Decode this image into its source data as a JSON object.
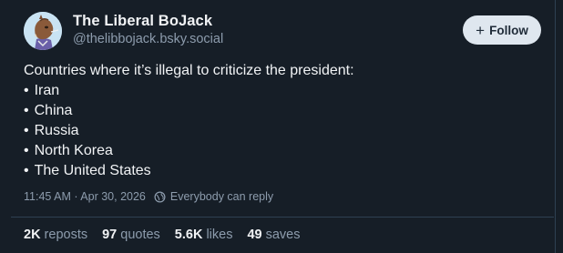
{
  "author": {
    "display_name": "The Liberal BoJack",
    "handle": "@thelibbojack.bsky.social",
    "avatar_icon": "bojack-avatar"
  },
  "follow_button": {
    "label": "Follow",
    "icon": "plus-icon"
  },
  "post": {
    "intro": "Countries where it’s illegal to criticize the president:",
    "items": [
      "Iran",
      "China",
      "Russia",
      "North Korea",
      "The United States"
    ]
  },
  "meta": {
    "timestamp": "11:45 AM · Apr 30, 2026",
    "reply_setting": "Everybody can reply",
    "reply_icon": "globe-icon"
  },
  "stats": {
    "reposts": {
      "count": "2K",
      "label": "reposts"
    },
    "quotes": {
      "count": "97",
      "label": "quotes"
    },
    "likes": {
      "count": "5.6K",
      "label": "likes"
    },
    "saves": {
      "count": "49",
      "label": "saves"
    }
  },
  "colors": {
    "background": "#161e27",
    "text": "#f1f3f5",
    "muted": "#8d9cad",
    "button_bg": "#dfe7ef"
  }
}
